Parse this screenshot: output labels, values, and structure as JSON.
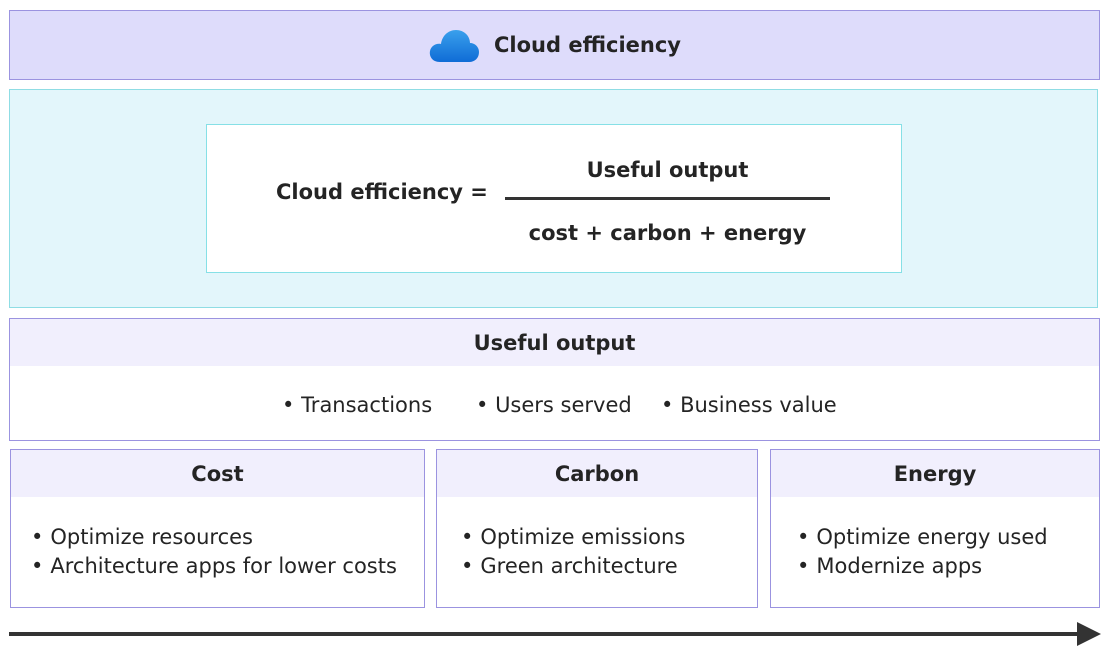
{
  "banner": {
    "icon": "cloud-icon",
    "title": "Cloud efficiency",
    "colors": {
      "background": "#dedcfb",
      "border": "#9b93e0",
      "cloud_light": "#3aa0ec",
      "cloud_dark": "#0f6cd6"
    }
  },
  "formula": {
    "lhs": "Cloud efficiency =",
    "numerator": "Useful output",
    "denominator": "cost + carbon + energy",
    "colors": {
      "section_background": "#e3f6fb",
      "section_border": "#8fdde4"
    }
  },
  "useful_output": {
    "title": "Useful output",
    "items": [
      "Transactions",
      "Users served",
      "Business value"
    ]
  },
  "columns": [
    {
      "title": "Cost",
      "items": [
        "Optimize resources",
        "Architecture apps for lower costs"
      ]
    },
    {
      "title": "Carbon",
      "items": [
        "Optimize emissions",
        "Green architecture"
      ]
    },
    {
      "title": "Energy",
      "items": [
        "Optimize energy used",
        "Modernize apps"
      ]
    }
  ],
  "arrow": {
    "icon": "right-arrow-icon",
    "color": "#333333"
  }
}
